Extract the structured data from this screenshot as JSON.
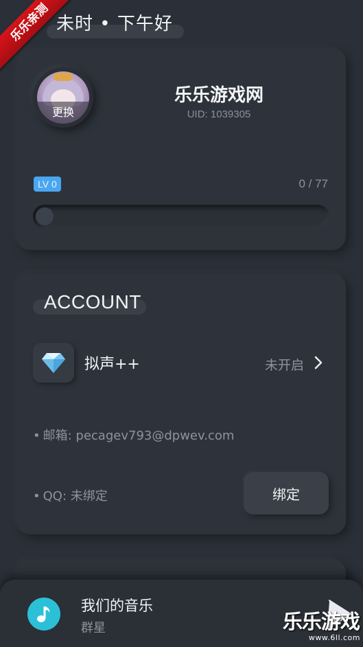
{
  "corner_badge": "乐乐亲测",
  "greeting": "未时 • 下午好",
  "profile": {
    "avatar_change_label": "更换",
    "username": "乐乐游戏网",
    "uid": "UID: 1039305",
    "level_badge": "LV 0",
    "exp_text": "0 / 77",
    "exp_progress": 0
  },
  "account": {
    "section_title": "ACCOUNT",
    "vip_label": "拟声++",
    "vip_status": "未开启",
    "email": "邮箱: pecagev793@dpwev.com",
    "qq": "QQ: 未绑定",
    "bind_button_label": "绑定",
    "bullet": "•"
  },
  "player": {
    "song_title": "我们的音乐",
    "artist": "群星"
  },
  "watermark": {
    "brand": "乐乐游戏",
    "url": "www.6ll.com"
  },
  "colors": {
    "background": "#2b3038",
    "accent_badge": "#4aa6f0",
    "music_icon": "#2bc0d8",
    "ribbon": "#d8141a"
  },
  "icons": {
    "vip": "diamond-icon",
    "chevron": "chevron-right-icon",
    "music": "music-note-icon",
    "play": "play-icon"
  }
}
